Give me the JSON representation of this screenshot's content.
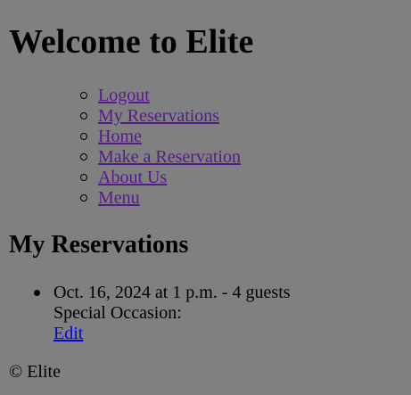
{
  "site": {
    "title": "Welcome to Elite"
  },
  "nav": {
    "items": [
      {
        "label": "Logout"
      },
      {
        "label": "My Reservations"
      },
      {
        "label": "Home"
      },
      {
        "label": "Make a Reservation"
      },
      {
        "label": "About Us"
      },
      {
        "label": "Menu"
      }
    ]
  },
  "main": {
    "heading": "My Reservations",
    "reservations": [
      {
        "summary": "Oct. 16, 2024 at 1 p.m. - 4 guests",
        "special_occasion": "Special Occasion:",
        "edit_label": "Edit"
      }
    ]
  },
  "footer": {
    "text": "© Elite"
  },
  "colors": {
    "background": "#808080",
    "visited_link": "#551a8b",
    "link": "#0000ee"
  }
}
